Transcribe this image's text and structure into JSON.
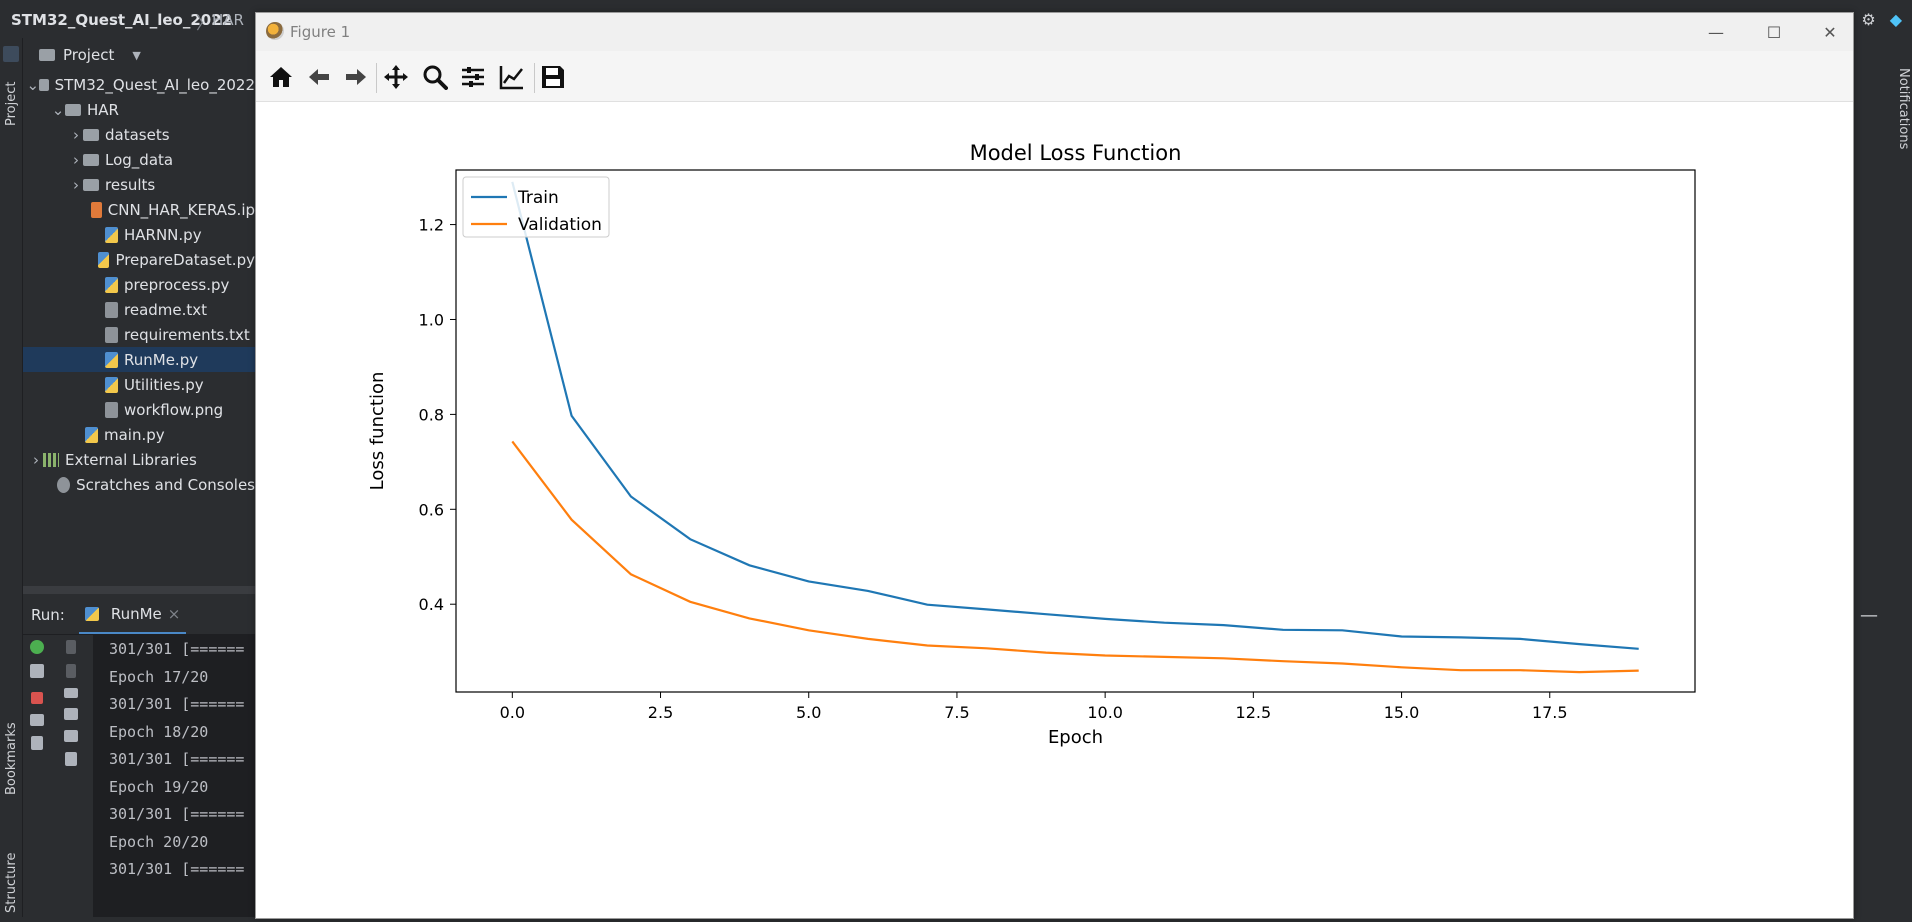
{
  "ide": {
    "project_name": "STM32_Quest_AI_leo_2022",
    "breadcrumb_sep": "〉",
    "breadcrumb_second": "HAR",
    "left_stripe": {
      "project": "Project",
      "bookmarks": "Bookmarks",
      "structure": "Structure"
    },
    "right_stripe": {
      "notifications": "Notifications"
    },
    "project_panel": {
      "header": "Project",
      "tree": [
        {
          "label": "STM32_Quest_AI_leo_2022",
          "kind": "folder",
          "expanded": true
        },
        {
          "label": "HAR",
          "kind": "folder",
          "expanded": true
        },
        {
          "label": "datasets",
          "kind": "folder",
          "expanded": false
        },
        {
          "label": "Log_data",
          "kind": "folder",
          "expanded": false
        },
        {
          "label": "results",
          "kind": "folder",
          "expanded": false
        },
        {
          "label": "CNN_HAR_KERAS.ip",
          "kind": "notebook"
        },
        {
          "label": "HARNN.py",
          "kind": "python"
        },
        {
          "label": "PrepareDataset.py",
          "kind": "python"
        },
        {
          "label": "preprocess.py",
          "kind": "python"
        },
        {
          "label": "readme.txt",
          "kind": "text"
        },
        {
          "label": "requirements.txt",
          "kind": "text"
        },
        {
          "label": "RunMe.py",
          "kind": "python",
          "selected": true
        },
        {
          "label": "Utilities.py",
          "kind": "python"
        },
        {
          "label": "workflow.png",
          "kind": "image"
        },
        {
          "label": "main.py",
          "kind": "python"
        },
        {
          "label": "External Libraries",
          "kind": "library",
          "expanded": false
        },
        {
          "label": "Scratches and Consoles",
          "kind": "scratch"
        }
      ]
    },
    "run_panel": {
      "label": "Run:",
      "tab": "RunMe",
      "tab_close": "×",
      "console_lines": [
        "301/301 [======",
        "Epoch 17/20",
        "301/301 [======",
        "Epoch 18/20",
        "301/301 [======",
        "Epoch 19/20",
        "301/301 [======",
        "Epoch 20/20",
        "301/301 [======"
      ]
    }
  },
  "figure_window": {
    "title": "Figure 1",
    "controls": {
      "minimize": "—",
      "maximize": "☐",
      "close": "✕"
    },
    "toolbar": [
      {
        "name": "home-icon"
      },
      {
        "name": "back-icon"
      },
      {
        "name": "forward-icon"
      },
      {
        "name": "pan-icon"
      },
      {
        "name": "zoom-icon"
      },
      {
        "name": "subplots-icon"
      },
      {
        "name": "edit-axis-icon"
      },
      {
        "name": "save-icon"
      }
    ]
  },
  "chart_data": {
    "type": "line",
    "title": "Model Loss Function",
    "xlabel": "Epoch",
    "ylabel": "Loss function",
    "xlim": [
      -0.95,
      19.95
    ],
    "ylim": [
      0.215,
      1.315
    ],
    "x_ticks": [
      0.0,
      2.5,
      5.0,
      7.5,
      10.0,
      12.5,
      15.0,
      17.5
    ],
    "x_tick_labels": [
      "0.0",
      "2.5",
      "5.0",
      "7.5",
      "10.0",
      "12.5",
      "15.0",
      "17.5"
    ],
    "y_ticks": [
      0.4,
      0.6,
      0.8,
      1.0,
      1.2
    ],
    "y_tick_labels": [
      "0.4",
      "0.6",
      "0.8",
      "1.0",
      "1.2"
    ],
    "grid": false,
    "legend_position": "upper-left",
    "x": [
      0,
      1,
      2,
      3,
      4,
      5,
      6,
      7,
      8,
      9,
      10,
      11,
      12,
      13,
      14,
      15,
      16,
      17,
      18,
      19
    ],
    "series": [
      {
        "name": "Train",
        "color": "#1f77b4",
        "values": [
          1.29,
          0.797,
          0.627,
          0.537,
          0.482,
          0.448,
          0.428,
          0.399,
          0.389,
          0.379,
          0.369,
          0.361,
          0.356,
          0.346,
          0.345,
          0.332,
          0.33,
          0.327,
          0.316,
          0.306
        ]
      },
      {
        "name": "Validation",
        "color": "#ff7f0e",
        "values": [
          0.743,
          0.578,
          0.463,
          0.405,
          0.37,
          0.345,
          0.327,
          0.313,
          0.307,
          0.298,
          0.292,
          0.289,
          0.286,
          0.28,
          0.275,
          0.267,
          0.261,
          0.261,
          0.257,
          0.26
        ]
      }
    ]
  }
}
